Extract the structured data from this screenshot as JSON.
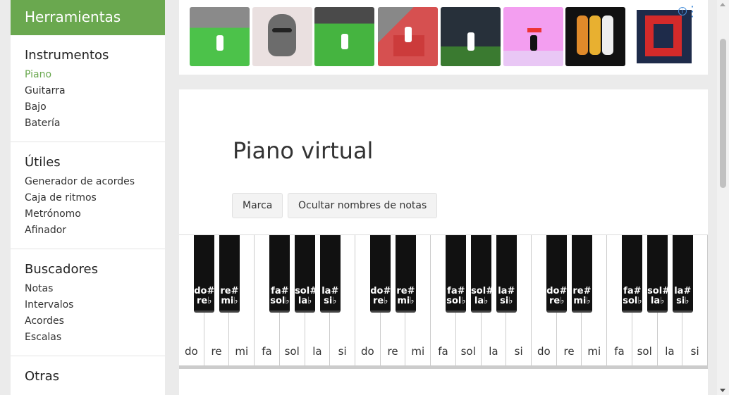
{
  "sidebar": {
    "header": "Herramientas",
    "sections": [
      {
        "title": "Instrumentos",
        "items": [
          "Piano",
          "Guitarra",
          "Bajo",
          "Batería"
        ],
        "active": "Piano"
      },
      {
        "title": "Útiles",
        "items": [
          "Generador de acordes",
          "Caja de ritmos",
          "Metrónomo",
          "Afinador"
        ]
      },
      {
        "title": "Buscadores",
        "items": [
          "Notas",
          "Intervalos",
          "Acordes",
          "Escalas"
        ]
      },
      {
        "title": "Otras",
        "items": []
      }
    ]
  },
  "ad": {
    "info_icon": "i",
    "thumb_colors": [
      "#4cc24a",
      "#eae0e0",
      "#45b440",
      "#d65050",
      "#27303a",
      "#f39ef0",
      "#111111"
    ],
    "accent": "#d42a2a"
  },
  "main": {
    "title": "Piano virtual",
    "buttons": {
      "mark": "Marca",
      "hide_names": "Ocultar nombres de notas"
    }
  },
  "piano": {
    "white_keys": [
      "do",
      "re",
      "mi",
      "fa",
      "sol",
      "la",
      "si",
      "do",
      "re",
      "mi",
      "fa",
      "sol",
      "la",
      "si",
      "do",
      "re",
      "mi",
      "fa",
      "sol",
      "la",
      "si"
    ],
    "black_keys": [
      "do#\nre♭",
      "re#\nmi♭",
      "fa#\nsol♭",
      "sol#\nla♭",
      "la#\nsi♭",
      "do#\nre♭",
      "re#\nmi♭",
      "fa#\nsol♭",
      "sol#\nla♭",
      "la#\nsi♭",
      "do#\nre♭",
      "re#\nmi♭",
      "fa#\nsol♭",
      "sol#\nla♭",
      "la#\nsi♭"
    ]
  }
}
